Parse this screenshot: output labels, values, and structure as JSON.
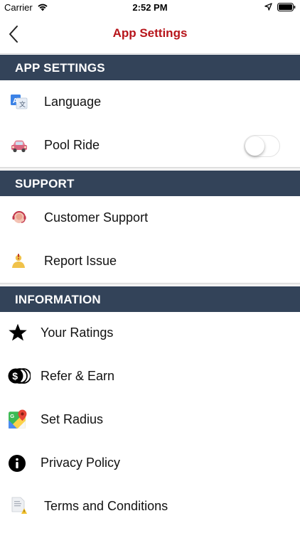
{
  "status_bar": {
    "carrier": "Carrier",
    "time": "2:52 PM",
    "icons": [
      "wifi-icon",
      "location-arrow-icon",
      "battery-icon"
    ]
  },
  "nav": {
    "title": "App Settings",
    "back_icon": "chevron-left-icon",
    "title_color": "#b7151b"
  },
  "colors": {
    "section_header_bg": "#334359",
    "section_header_text": "#ffffff"
  },
  "sections": [
    {
      "header": "APP SETTINGS",
      "items": [
        {
          "label": "Language",
          "icon": "translate-icon"
        },
        {
          "label": "Pool Ride",
          "icon": "car-icon",
          "toggle_on": false
        }
      ]
    },
    {
      "header": "SUPPORT",
      "items": [
        {
          "label": "Customer Support",
          "icon": "support-agent-icon"
        },
        {
          "label": "Report Issue",
          "icon": "report-person-icon"
        }
      ]
    },
    {
      "header": "INFORMATION",
      "items": [
        {
          "label": "Your Ratings",
          "icon": "star-icon"
        },
        {
          "label": "Refer & Earn",
          "icon": "coins-icon"
        },
        {
          "label": "Set Radius",
          "icon": "map-pin-icon"
        },
        {
          "label": "Privacy Policy",
          "icon": "info-icon"
        },
        {
          "label": "Terms and Conditions",
          "icon": "document-icon"
        }
      ]
    }
  ]
}
